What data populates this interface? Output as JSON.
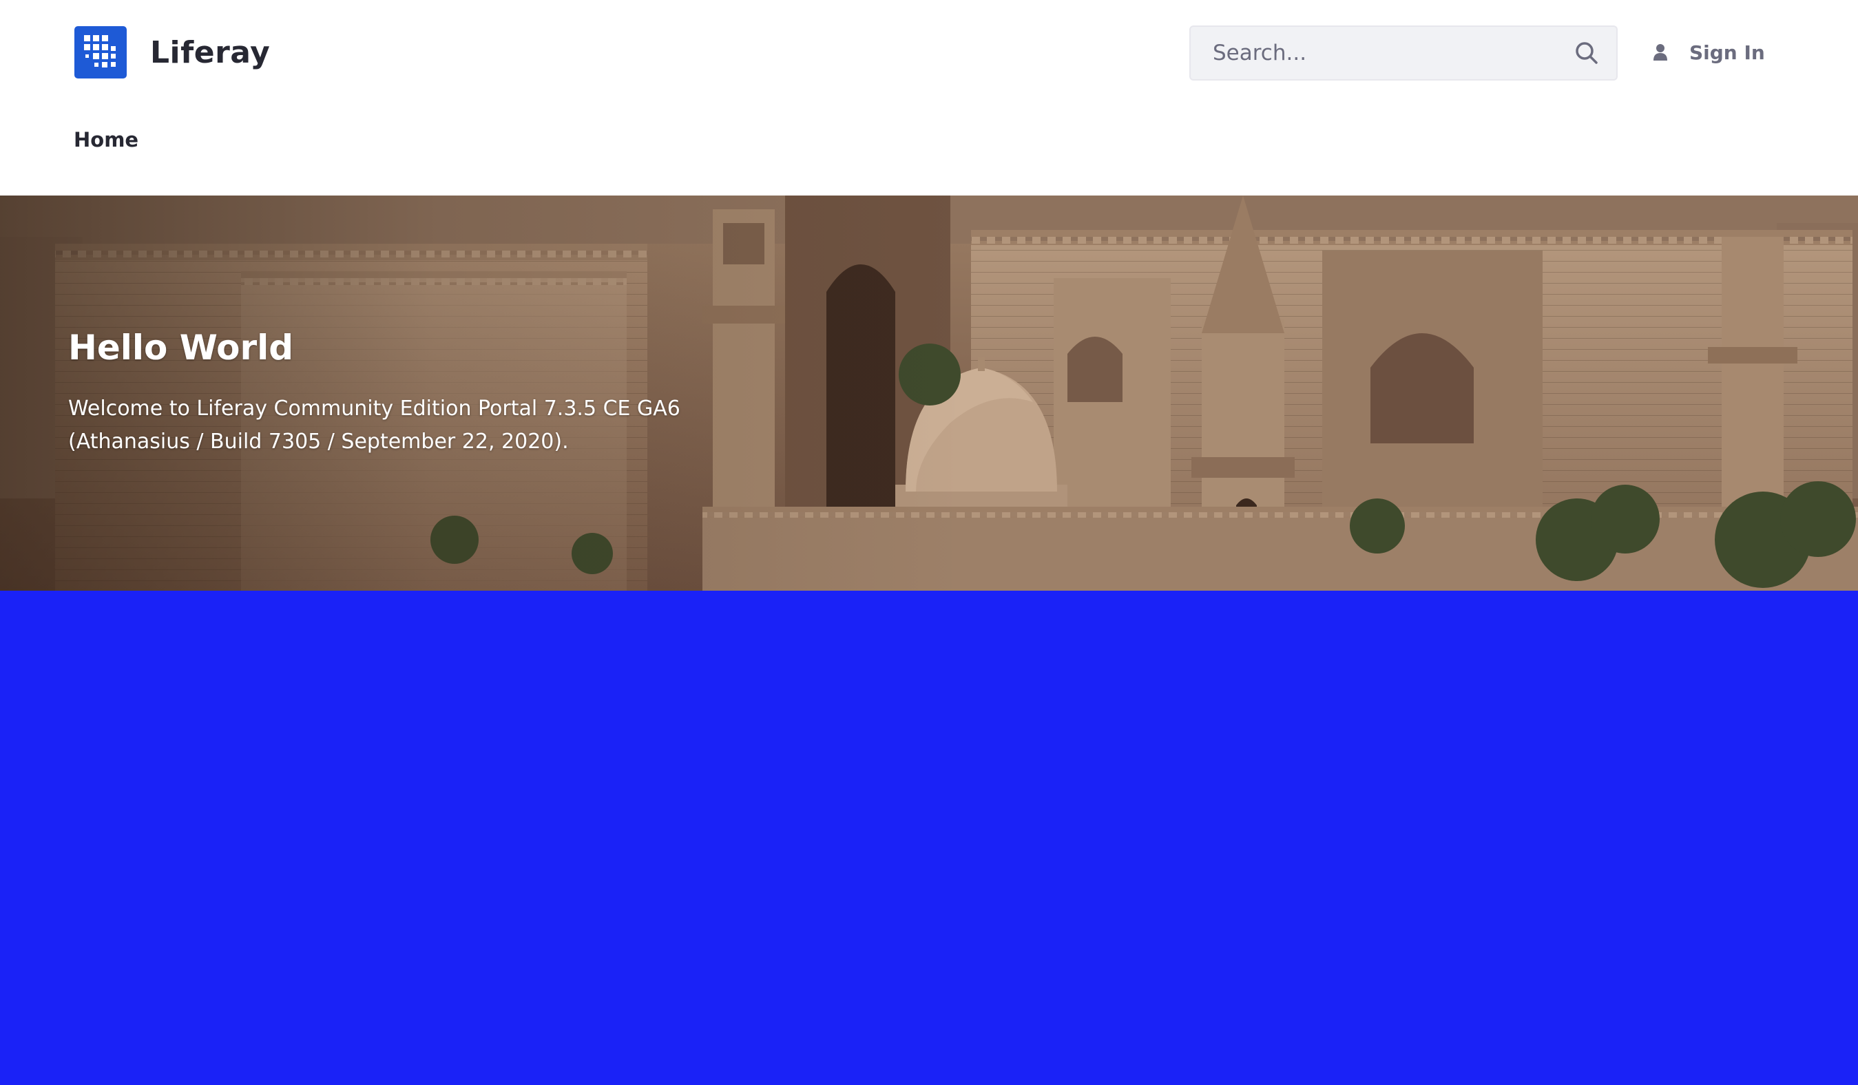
{
  "site": {
    "name": "Liferay",
    "logo_icon": "liferay-grid-logo",
    "logo_color": "#1e5ad6"
  },
  "search": {
    "placeholder": "Search...",
    "value": "",
    "icon": "search-icon"
  },
  "user": {
    "sign_in_label": "Sign In",
    "icon": "user-icon"
  },
  "nav": {
    "items": [
      {
        "label": "Home"
      }
    ]
  },
  "hero": {
    "title": "Hello World",
    "body": "Welcome to Liferay Community Edition Portal 7.3.5 CE GA6 (Athanasius / Build 7305 / September 22, 2020)."
  },
  "colors": {
    "header_bg": "#ffffff",
    "text_dark": "#272833",
    "text_secondary": "#6b6c7e",
    "lower_area_bg": "#1a22f7"
  }
}
